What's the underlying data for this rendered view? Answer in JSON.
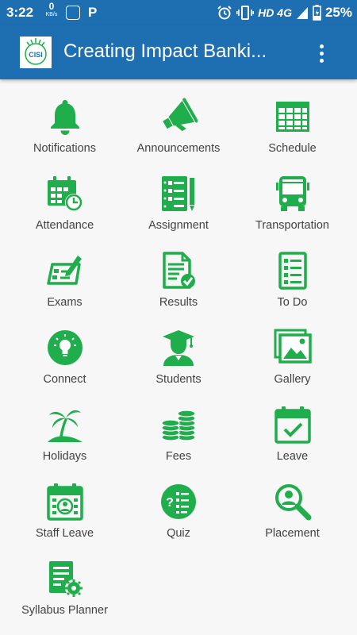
{
  "status_bar": {
    "time": "3:22",
    "net_speed_value": "0",
    "net_speed_unit": "KB/s",
    "p_icon": "P",
    "network": "HD 4G",
    "battery": "25%",
    "icons": [
      "alarm-icon",
      "vibrate-icon",
      "signal-icon",
      "battery-charging-icon"
    ]
  },
  "app_bar": {
    "logo_text": "CISI",
    "title": "Creating Impact Banki...",
    "menu_icon": "more-vert-icon",
    "background_color": "#1d6fb2"
  },
  "accent_color": "#1fae4b",
  "menu": [
    {
      "label": "Notifications",
      "icon": "bell-icon"
    },
    {
      "label": "Announcements",
      "icon": "megaphone-icon"
    },
    {
      "label": "Schedule",
      "icon": "table-icon"
    },
    {
      "label": "Attendance",
      "icon": "calendar-clock-icon"
    },
    {
      "label": "Assignment",
      "icon": "notebook-pencil-icon"
    },
    {
      "label": "Transportation",
      "icon": "bus-icon"
    },
    {
      "label": "Exams",
      "icon": "exam-paper-icon"
    },
    {
      "label": "Results",
      "icon": "document-check-icon"
    },
    {
      "label": "To Do",
      "icon": "checklist-icon"
    },
    {
      "label": "Connect",
      "icon": "lightbulb-icon"
    },
    {
      "label": "Students",
      "icon": "graduate-icon"
    },
    {
      "label": "Gallery",
      "icon": "picture-icon"
    },
    {
      "label": "Holidays",
      "icon": "palm-tree-icon"
    },
    {
      "label": "Fees",
      "icon": "coins-icon"
    },
    {
      "label": "Leave",
      "icon": "calendar-check-icon"
    },
    {
      "label": "Staff Leave",
      "icon": "calendar-person-icon"
    },
    {
      "label": "Quiz",
      "icon": "quiz-icon"
    },
    {
      "label": "Placement",
      "icon": "search-person-icon"
    },
    {
      "label": "Syllabus Planner",
      "icon": "document-gear-icon"
    }
  ]
}
